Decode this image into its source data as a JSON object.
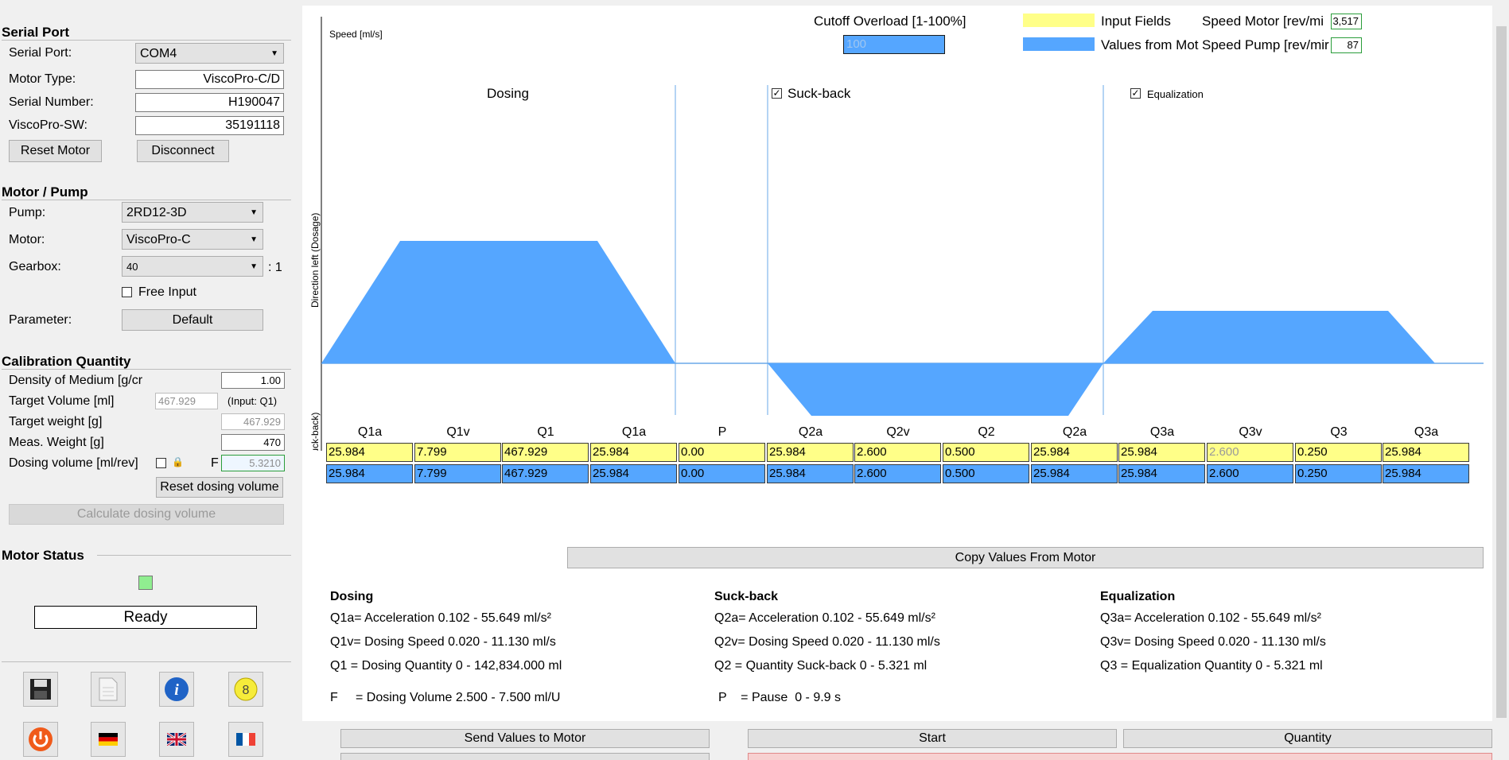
{
  "serial_port": {
    "title": "Serial Port",
    "port_label": "Serial Port:",
    "port_value": "COM4",
    "motor_type_label": "Motor Type:",
    "motor_type_value": "ViscoPro-C/D",
    "serial_label": "Serial Number:",
    "serial_value": "H190047",
    "sw_label": "ViscoPro-SW:",
    "sw_value": "35191118",
    "reset_label": "Reset Motor",
    "disconnect_label": "Disconnect"
  },
  "motor_pump": {
    "title": "Motor / Pump",
    "pump_label": "Pump:",
    "pump_value": "2RD12-3D",
    "motor_label": "Motor:",
    "motor_value": "ViscoPro-C",
    "gearbox_label": "Gearbox:",
    "gearbox_value": "40",
    "gearbox_ratio": ": 1",
    "free_input_label": "Free Input",
    "parameter_label": "Parameter:",
    "parameter_button": "Default"
  },
  "calibration": {
    "title": "Calibration Quantity",
    "density_label": "Density of Medium [g/cr",
    "density_value": "1.00",
    "target_volume_label": "Target Volume [ml]",
    "target_volume_value": "467.929",
    "target_volume_note": "(Input: Q1)",
    "target_weight_label": "Target weight [g]",
    "target_weight_value": "467.929",
    "meas_weight_label": "Meas. Weight [g]",
    "meas_weight_value": "470",
    "dosing_volume_label": "Dosing volume [ml/rev]",
    "dosing_f": "F",
    "dosing_volume_value": "5.3210",
    "reset_dosing_label": "Reset dosing volume",
    "calculate_label": "Calculate dosing volume"
  },
  "motor_status": {
    "title": "Motor Status",
    "status_text": "Ready",
    "led_color": "#90ee90"
  },
  "chart_panel": {
    "speed_label": "Speed [ml/s]",
    "cutoff_label": "Cutoff Overload [1-100%]",
    "cutoff_value": "100",
    "legend_input": "Input Fields",
    "legend_values": "Values from Mot",
    "speed_motor_label": "Speed Motor [rev/mi",
    "speed_motor_value": "3,517",
    "speed_pump_label": "Speed Pump [rev/mir",
    "speed_pump_value": "87",
    "dosing_label": "Dosing",
    "suckback_label": "Suck-back",
    "equalization_label": "Equalization",
    "dir_left_label": "Direction left (Dosage)",
    "dir_right_label": "Direction right (Suck-back)",
    "input_color": "#ffff88",
    "motor_color": "#55a6ff"
  },
  "table": {
    "headers": [
      "Q1a",
      "Q1v",
      "Q1",
      "Q1a",
      "P",
      "Q2a",
      "Q2v",
      "Q2",
      "Q2a",
      "Q3a",
      "Q3v",
      "Q3",
      "Q3a"
    ],
    "input_row": [
      "25.984",
      "7.799",
      "467.929",
      "25.984",
      "0.00",
      "25.984",
      "2.600",
      "0.500",
      "25.984",
      "25.984",
      "2.600",
      "0.250",
      "25.984"
    ],
    "motor_row": [
      "25.984",
      "7.799",
      "467.929",
      "25.984",
      "0.00",
      "25.984",
      "2.600",
      "0.500",
      "25.984",
      "25.984",
      "2.600",
      "0.250",
      "25.984"
    ]
  },
  "copy_button_label": "Copy Values From Motor",
  "info": {
    "dosing_title": "Dosing",
    "dosing_lines": [
      "Q1a= Acceleration 0.102 - 55.649 ml/s²",
      "Q1v= Dosing Speed 0.020 - 11.130 ml/s",
      "Q1  = Dosing Quantity 0 - 142,834.000 ml"
    ],
    "f_line": "F     = Dosing Volume 2.500 - 7.500 ml/U",
    "suckback_title": "Suck-back",
    "suckback_lines": [
      "Q2a= Acceleration 0.102 - 55.649 ml/s²",
      "Q2v= Dosing Speed 0.020 - 11.130 ml/s",
      "Q2  = Quantity Suck-back 0 - 5.321 ml"
    ],
    "p_line": "P    = Pause  0 - 9.9 s",
    "equalization_title": "Equalization",
    "equalization_lines": [
      "Q3a= Acceleration 0.102 - 55.649 ml/s²",
      "Q3v= Dosing Speed 0.020 - 11.130 ml/s",
      "Q3  = Equalization Quantity 0 - 5.321 ml"
    ]
  },
  "bottom": {
    "send_label": "Send Values to Motor",
    "start_label": "Start",
    "quantity_label": "Quantity"
  },
  "icons": {
    "number_badge": "8"
  }
}
